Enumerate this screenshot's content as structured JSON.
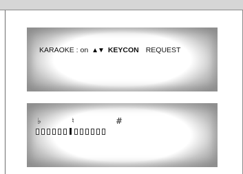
{
  "osd_menu": {
    "karaoke_label": "KARAOKE : on",
    "arrows_icon": "▲▼",
    "keycon_label": "KEYCON",
    "request_label": "REQUEST"
  },
  "key_control": {
    "flat_symbol": "♭",
    "natural_symbol": "♮",
    "sharp_symbol": "#",
    "total_steps": 13,
    "current_step": 7
  }
}
